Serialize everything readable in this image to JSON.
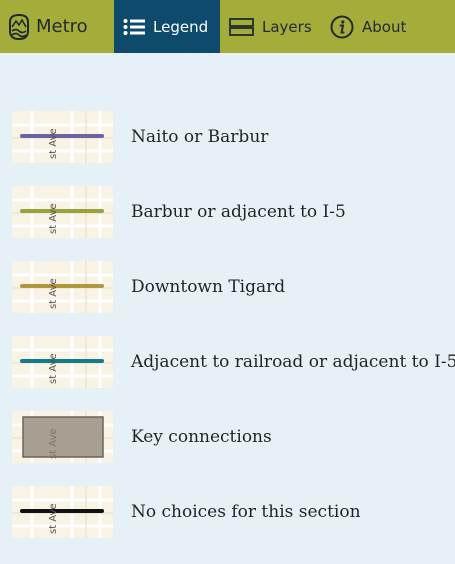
{
  "header": {
    "brand": {
      "name": "Metro",
      "icon": "metro-logo-icon"
    },
    "tabs": [
      {
        "label": "Legend",
        "icon": "list-icon",
        "active": true
      },
      {
        "label": "Layers",
        "icon": "layers-icon",
        "active": false
      },
      {
        "label": "About",
        "icon": "info-icon",
        "active": false
      }
    ]
  },
  "legend": {
    "map_street_label": "st Ave",
    "items": [
      {
        "label": "Naito or Barbur",
        "swatch": "line",
        "color": "#6b63a4"
      },
      {
        "label": "Barbur or adjacent to I-5",
        "swatch": "line",
        "color": "#96a43a"
      },
      {
        "label": "Downtown Tigard",
        "swatch": "line",
        "color": "#b1983e"
      },
      {
        "label": "Adjacent to railroad or adjacent to I-5",
        "swatch": "line",
        "color": "#147b8c"
      },
      {
        "label": "Key connections",
        "swatch": "area",
        "color": "#a89f93"
      },
      {
        "label": "No choices for this section",
        "swatch": "line",
        "color": "#111111"
      }
    ]
  },
  "colors": {
    "header_bar": "#a5ad3a",
    "active_tab": "#0e4a6b",
    "panel_background": "#e6f0f7"
  }
}
